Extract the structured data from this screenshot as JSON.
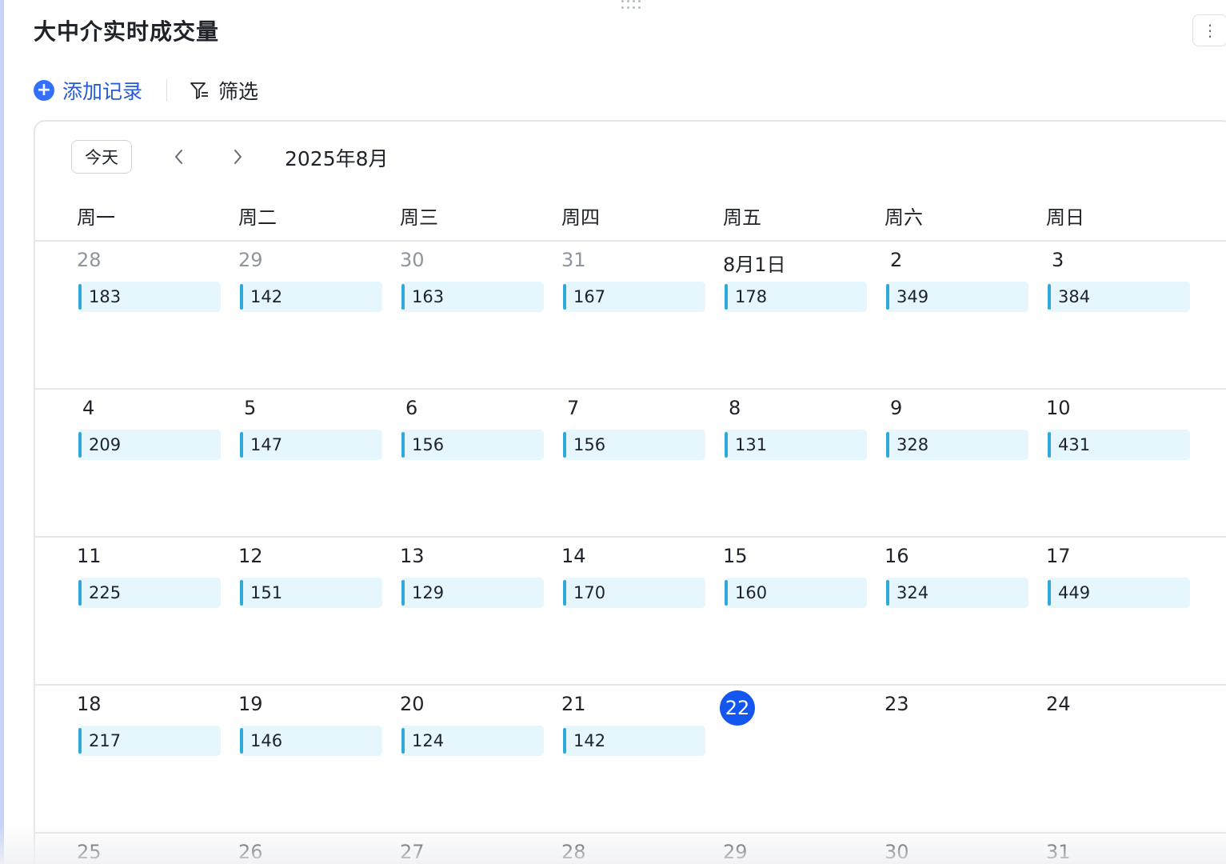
{
  "widget": {
    "title": "大中介实时成交量",
    "more_icon": "more-vertical-icon"
  },
  "toolbar": {
    "add_record_label": "添加记录",
    "add_icon": "plus-circle-icon",
    "filter_label": "筛选",
    "filter_icon": "filter-icon"
  },
  "calendar": {
    "today_label": "今天",
    "prev_icon": "chevron-left-icon",
    "next_icon": "chevron-right-icon",
    "month_label": "2025年8月",
    "weekdays": [
      "周一",
      "周二",
      "周三",
      "周四",
      "周五",
      "周六",
      "周日"
    ],
    "today_date": "22",
    "weeks": [
      [
        {
          "label": "28",
          "other_month": true,
          "value": "183"
        },
        {
          "label": "29",
          "other_month": true,
          "value": "142"
        },
        {
          "label": "30",
          "other_month": true,
          "value": "163"
        },
        {
          "label": "31",
          "other_month": true,
          "value": "167"
        },
        {
          "label": "8月1日",
          "other_month": false,
          "value": "178"
        },
        {
          "label": "2",
          "other_month": false,
          "value": "349"
        },
        {
          "label": "3",
          "other_month": false,
          "value": "384"
        }
      ],
      [
        {
          "label": "4",
          "other_month": false,
          "value": "209"
        },
        {
          "label": "5",
          "other_month": false,
          "value": "147"
        },
        {
          "label": "6",
          "other_month": false,
          "value": "156"
        },
        {
          "label": "7",
          "other_month": false,
          "value": "156"
        },
        {
          "label": "8",
          "other_month": false,
          "value": "131"
        },
        {
          "label": "9",
          "other_month": false,
          "value": "328"
        },
        {
          "label": "10",
          "other_month": false,
          "value": "431"
        }
      ],
      [
        {
          "label": "11",
          "other_month": false,
          "value": "225"
        },
        {
          "label": "12",
          "other_month": false,
          "value": "151"
        },
        {
          "label": "13",
          "other_month": false,
          "value": "129"
        },
        {
          "label": "14",
          "other_month": false,
          "value": "170"
        },
        {
          "label": "15",
          "other_month": false,
          "value": "160"
        },
        {
          "label": "16",
          "other_month": false,
          "value": "324"
        },
        {
          "label": "17",
          "other_month": false,
          "value": "449"
        }
      ],
      [
        {
          "label": "18",
          "other_month": false,
          "value": "217"
        },
        {
          "label": "19",
          "other_month": false,
          "value": "146"
        },
        {
          "label": "20",
          "other_month": false,
          "value": "124"
        },
        {
          "label": "21",
          "other_month": false,
          "value": "142"
        },
        {
          "label": "22",
          "other_month": false,
          "value": null,
          "is_today": true
        },
        {
          "label": "23",
          "other_month": false,
          "value": null
        },
        {
          "label": "24",
          "other_month": false,
          "value": null
        }
      ],
      [
        {
          "label": "25",
          "other_month": false,
          "value": null
        },
        {
          "label": "26",
          "other_month": false,
          "value": null
        },
        {
          "label": "27",
          "other_month": false,
          "value": null
        },
        {
          "label": "28",
          "other_month": false,
          "value": null
        },
        {
          "label": "29",
          "other_month": false,
          "value": null
        },
        {
          "label": "30",
          "other_month": false,
          "value": null
        },
        {
          "label": "31",
          "other_month": false,
          "value": null
        }
      ]
    ]
  },
  "colors": {
    "accent": "#3370ff",
    "today": "#1456f0",
    "event_bg": "#e6f6fd",
    "event_bar": "#2fa9d9"
  }
}
